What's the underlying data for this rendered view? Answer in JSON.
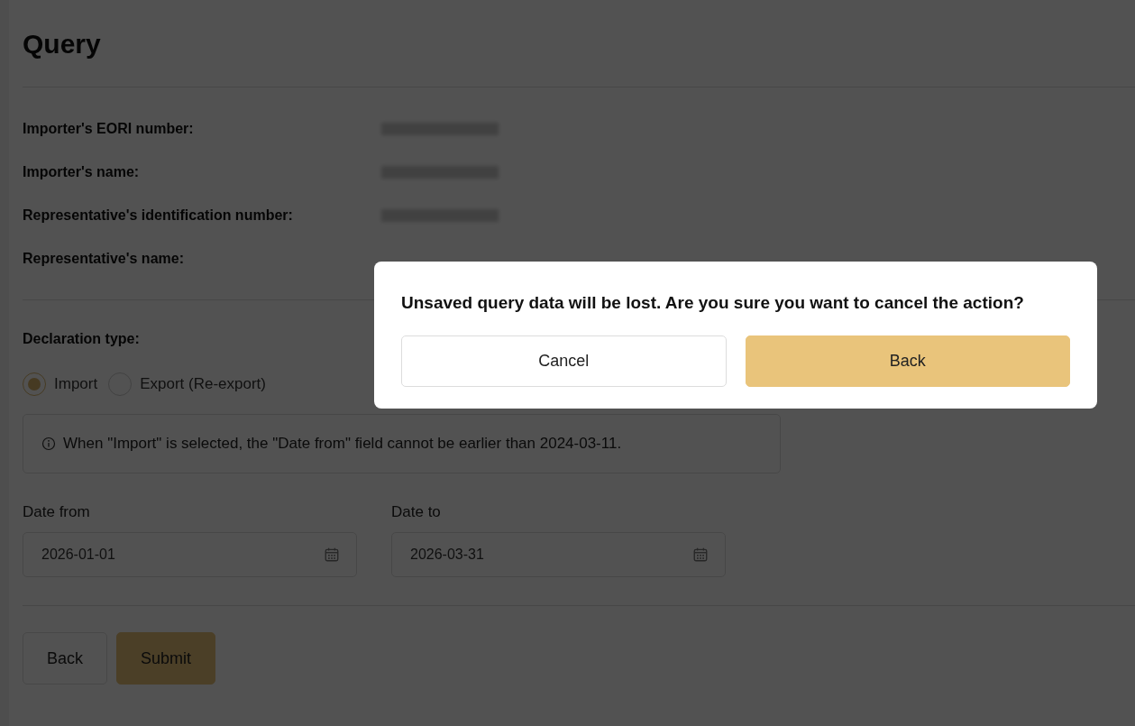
{
  "page": {
    "title": "Query"
  },
  "details": [
    {
      "label": "Importer's EORI number:",
      "redacted": true
    },
    {
      "label": "Importer's name:",
      "redacted": true
    },
    {
      "label": "Representative's identification number:",
      "redacted": true
    },
    {
      "label": "Representative's name:",
      "redacted": false
    }
  ],
  "declaration_type": {
    "label": "Declaration type:",
    "options": [
      {
        "label": "Import",
        "selected": true
      },
      {
        "label": "Export (Re-export)",
        "selected": false
      }
    ]
  },
  "info_note": "When \"Import\" is selected, the \"Date from\" field cannot be earlier than 2024-03-11.",
  "dates": [
    {
      "label": "Date from",
      "value": "2026-01-01"
    },
    {
      "label": "Date to",
      "value": "2026-03-31"
    }
  ],
  "actions": [
    {
      "label": "Back",
      "kind": "secondary"
    },
    {
      "label": "Submit",
      "kind": "primary"
    }
  ],
  "dialog": {
    "message": "Unsaved query data will be lost. Are you sure you want to cancel the action?",
    "buttons": [
      {
        "label": "Cancel",
        "kind": "secondary"
      },
      {
        "label": "Back",
        "kind": "primary"
      }
    ]
  }
}
